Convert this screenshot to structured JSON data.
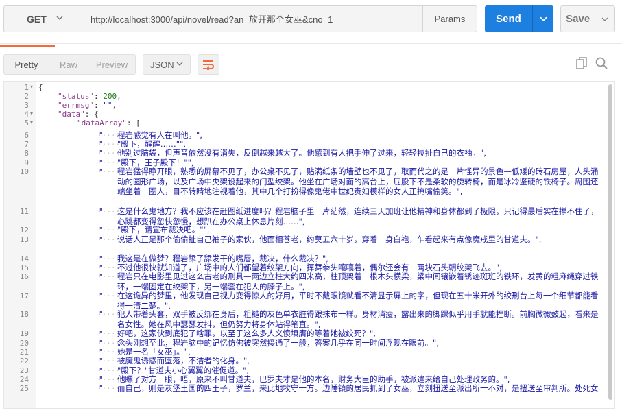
{
  "request": {
    "method": "GET",
    "url": "http://localhost:3000/api/novel/read?an=放开那个女巫&cno=1",
    "params_label": "Params",
    "send_label": "Send",
    "save_label": "Save"
  },
  "response": {
    "view_tabs": [
      "Pretty",
      "Raw",
      "Preview"
    ],
    "format": "JSON",
    "lines": {
      "l1": "{",
      "l2_key": "\"status\"",
      "l2_val": "200",
      "l3_key": "\"errmsg\"",
      "l3_val": "\"\"",
      "l4_key": "\"data\"",
      "l5_key": "\"dataArray\""
    },
    "paragraphs": [
      {
        "n": "6",
        "text": "程岩感觉有人在叫他。\","
      },
      {
        "n": "7",
        "text": "\"殿下，醒醒……\"\","
      },
      {
        "n": "8",
        "text": "他别过脑袋，但声音依然没有消失，反倒越来越大了。他感到有人把手伸了过来，轻轻拉扯自己的衣袖。\","
      },
      {
        "n": "9",
        "text": "\"殿下，王子殿下！\"\","
      },
      {
        "n": "10",
        "text": "程岩猛得睁开眼，熟悉的屏幕不见了，办公桌不见了，贴满纸条的墙壁也不见了，取而代之的是一片怪异的景色—低矮的砖石房屋，人头涌动的圆形广场，以及广场中央架设起来的门型绞架。他坐在广场对面的高台上，屁股下不是柔软的旋转椅，而是冰冷坚硬的铁椅子。周围还端坐着一圈人，目不转睛地注视着他，其中几个打扮得像鬼佬中世纪贵妇模样的女人正掩嘴偷笑。\","
      },
      {
        "n": "11",
        "text": "这是什么鬼地方？我不应该在赶图纸进度吗？程岩脑子里一片茫然，连续三天加班让他精神和身体都到了极限，只记得最后实在撑不住了，心跳都变得忽快忽慢，想趴在办公桌上休息片刻……\","
      },
      {
        "n": "12",
        "text": "\"殿下，请宣布裁决吧。\"\","
      },
      {
        "n": "13",
        "text": "说话人正是那个偷偷扯自己袖子的家伙，他面相苍老，约莫五六十岁，穿着一身白袍，乍看起来有点像魔戒里的甘道夫。\","
      },
      {
        "n": "14",
        "text": "我这是在做梦？程岩舔了舔发干的嘴唇，裁决，什么裁决？\","
      },
      {
        "n": "15",
        "text": "不过他很快就知道了，广场中的人们都望着绞架方向，挥舞拳头嚷嚷着，偶尔还会有一两块石头朝绞架飞去。\","
      },
      {
        "n": "16",
        "text": "程岩只在电影里见过这么古老的刑具—两边立柱大约四米高，柱顶架着一根木头横梁，梁中间镶嵌着锈迹斑斑的铁环，发黄的粗麻绳穿过铁环，一端固定在绞架下，另一端套在犯人的脖子上。\","
      },
      {
        "n": "17",
        "text": "在这诡异的梦里，他发现自己视力变得惊人的好用，平时不戴眼镜就看不清显示屏上的字，但现在五十米开外的绞刑台上每一个细节都能看得一清二楚。\","
      },
      {
        "n": "18",
        "text": "犯人带着头套，双手被反绑在身后，粗糙的灰色单衣脏得跟抹布一样。身材消瘦，露出来的脚踝似乎用手就能捏断。前胸微微鼓起，看来是名女性。她在风中瑟瑟发抖，但仍努力将身体站得笔直。\","
      },
      {
        "n": "19",
        "text": "好吧，这家伙到底犯了啥罪，以至于这么多人义愤填膺的等着她被绞死？\","
      },
      {
        "n": "20",
        "text": "念头刚想至此，程岩脑中的记忆仿佛被突然接通了一般，答案几乎在同一时间浮现在眼前。\","
      },
      {
        "n": "21",
        "text": "她是一名「女巫」。\","
      },
      {
        "n": "22",
        "text": "被魔鬼诱惑而堕落，不洁者的化身。\","
      },
      {
        "n": "23",
        "text": "\"殿下？\"甘道夫小心翼翼的催促道。\","
      },
      {
        "n": "24",
        "text": "他瞟了对方一眼，唔，原来不叫甘道夫，巴罗夫才是他的本名，财务大臣的助手，被派遣来给自己处理政务的。\","
      },
      {
        "n": "25",
        "text": "而自己，则是灰堡王国的四王子，罗兰，来此地牧守一方。边陲镇的居民抓到了女巫，立刻扭送至派出所一不对，是扭送至审判所。处死女巫的手令一般由地方领主或主教签发，既然自己在此地执政，签发手令也成了分内之事。\","
      }
    ]
  }
}
